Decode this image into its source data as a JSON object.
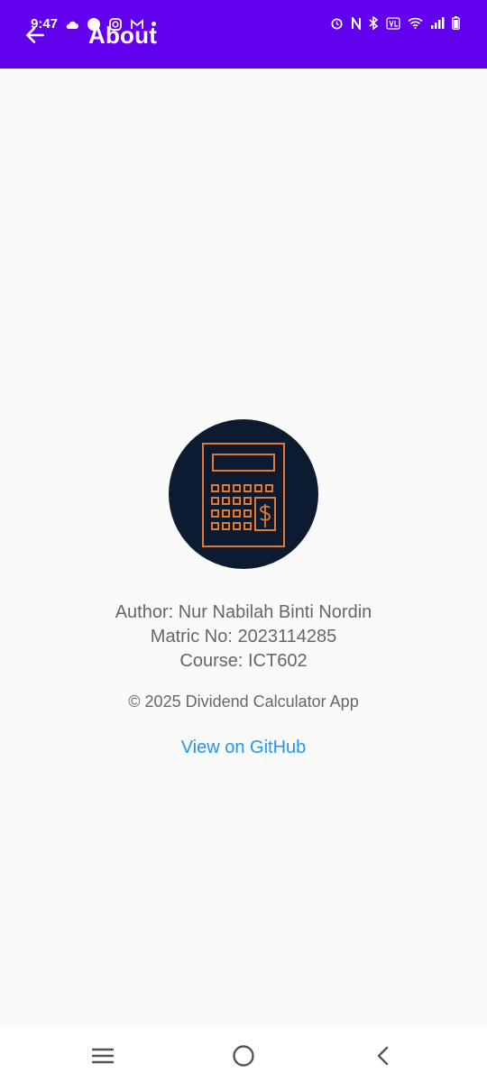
{
  "status_bar": {
    "time": "9:47",
    "accent_color": "#6200ee"
  },
  "app_bar": {
    "title": "About",
    "back_icon": "arrow-back-icon"
  },
  "about": {
    "logo_icon": "calculator-dollar-icon",
    "author": "Author: Nur Nabilah Binti Nordin",
    "matric": "Matric No: 2023114285",
    "course": "Course: ICT602",
    "copyright": "© 2025 Dividend Calculator App",
    "github_link": "View on GitHub",
    "link_color": "#2196f3"
  },
  "nav_bar": {
    "recents_icon": "menu-lines-icon",
    "home_icon": "home-circle-icon",
    "back_icon": "chevron-left-icon"
  }
}
